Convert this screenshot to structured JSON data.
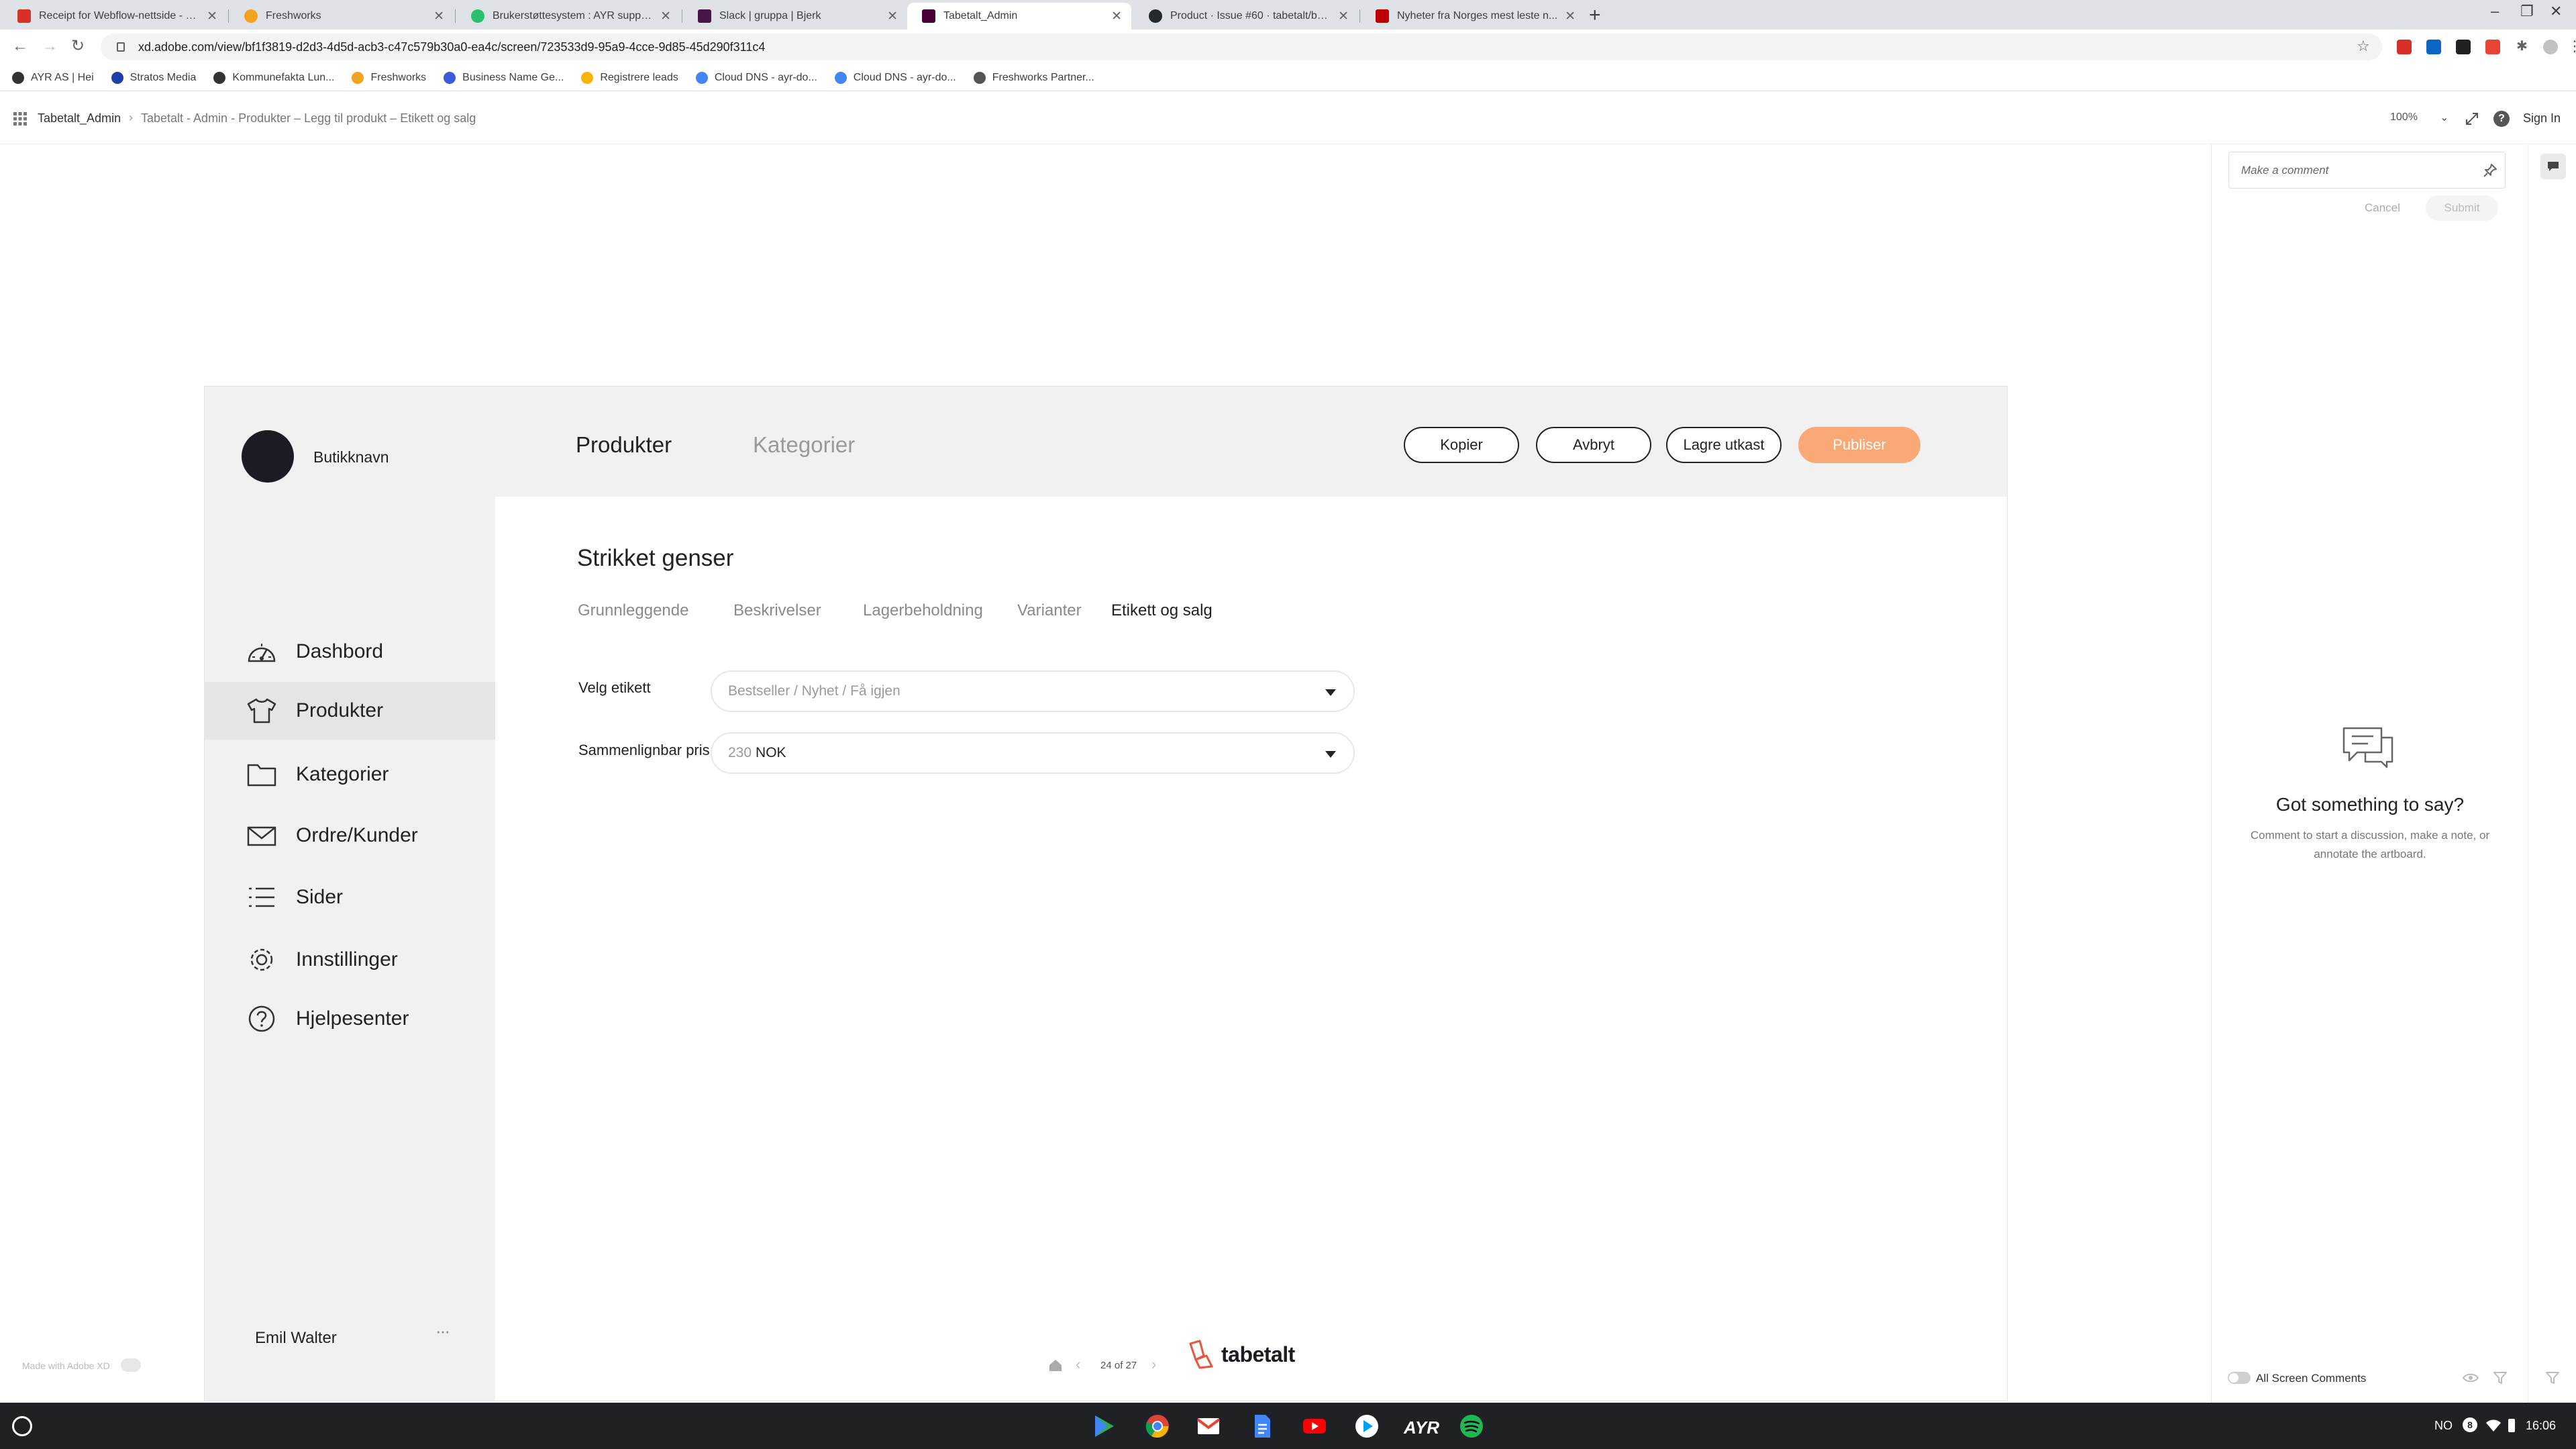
{
  "browser": {
    "tabs": [
      {
        "title": "Receipt for Webflow-nettside - b...",
        "icon": "gmail-icon",
        "color": "#d93025",
        "active": false
      },
      {
        "title": "Freshworks",
        "icon": "freshworks-icon",
        "color": "#f4a31c",
        "active": false
      },
      {
        "title": "Brukerstøttesystem : AYR suppo...",
        "icon": "freshdesk-icon",
        "color": "#25c16f",
        "active": false
      },
      {
        "title": "Slack | gruppa | Bjerk",
        "icon": "slack-icon",
        "color": "#4a154b",
        "active": false
      },
      {
        "title": "Tabetalt_Admin",
        "icon": "adobe-xd-icon",
        "color": "#470137",
        "active": true
      },
      {
        "title": "Product · Issue #60 · tabetalt/ba...",
        "icon": "github-icon",
        "color": "#24292e",
        "active": false
      },
      {
        "title": "Nyheter fra Norges mest leste n...",
        "icon": "vg-icon",
        "color": "#c00000",
        "active": false
      }
    ],
    "url": "xd.adobe.com/view/bf1f3819-d2d3-4d5d-acb3-c47c579b30a0-ea4c/screen/723533d9-95a9-4cce-9d85-45d290f311c4",
    "bookmarks": [
      "AYR AS | Hei",
      "Stratos Media",
      "Kommunefakta Lun...",
      "Freshworks",
      "Business Name Ge...",
      "Registrere leads",
      "Cloud DNS - ayr-do...",
      "Cloud DNS - ayr-do...",
      "Freshworks Partner..."
    ]
  },
  "xd_header": {
    "project": "Tabetalt_Admin",
    "breadcrumb": "Tabetalt - Admin - Produkter – Legg til produkt – Etikett og salg",
    "zoom": "100%",
    "sign_in": "Sign In"
  },
  "app": {
    "store_name": "Butikknavn",
    "nav": [
      {
        "label": "Dashbord",
        "icon": "dashboard-gauge-icon",
        "active": false
      },
      {
        "label": "Produkter",
        "icon": "tshirt-icon",
        "active": true
      },
      {
        "label": "Kategorier",
        "icon": "folder-icon",
        "active": false
      },
      {
        "label": "Ordre/Kunder",
        "icon": "envelope-tray-icon",
        "active": false
      },
      {
        "label": "Sider",
        "icon": "list-icon",
        "active": false
      },
      {
        "label": "Innstillinger",
        "icon": "gear-icon",
        "active": false
      },
      {
        "label": "Hjelpesenter",
        "icon": "help-circle-icon",
        "active": false
      }
    ],
    "user_name": "Emil Walter",
    "user_menu": "···",
    "top_tabs": {
      "products": "Produkter",
      "categories": "Kategorier"
    },
    "actions": {
      "copy": "Kopier",
      "cancel": "Avbryt",
      "save_draft": "Lagre utkast",
      "publish": "Publiser"
    },
    "product_title": "Strikket genser",
    "sub_tabs": [
      "Grunnleggende",
      "Beskrivelser",
      "Lagerbeholdning",
      "Varianter",
      "Etikett og salg"
    ],
    "active_sub_tab": "Etikett og salg",
    "form": {
      "label_field": "Velg etikett",
      "label_placeholder": "Bestseller / Nyhet / Få igjen",
      "price_field": "Sammenlignbar pris",
      "price_value": "230",
      "price_currency": "NOK"
    },
    "brand": "tabetalt",
    "brand_color": "#e8553a",
    "accent": "#fba877"
  },
  "comments": {
    "placeholder": "Make a comment",
    "cancel": "Cancel",
    "submit": "Submit",
    "empty_title": "Got something to say?",
    "empty_text_1": "Comment to start a discussion, make a note, or",
    "empty_text_2": "annotate the artboard.",
    "all_screen_comments": "All Screen Comments"
  },
  "footer": {
    "made_with": "Made with Adobe XD",
    "page_indicator": "24 of 27"
  },
  "taskbar": {
    "lang": "NO",
    "time": "16:06",
    "apps": [
      "play-store-icon",
      "chrome-icon",
      "gmail-icon",
      "docs-icon",
      "youtube-icon",
      "play-icon",
      "ayr-icon",
      "spotify-icon"
    ]
  }
}
